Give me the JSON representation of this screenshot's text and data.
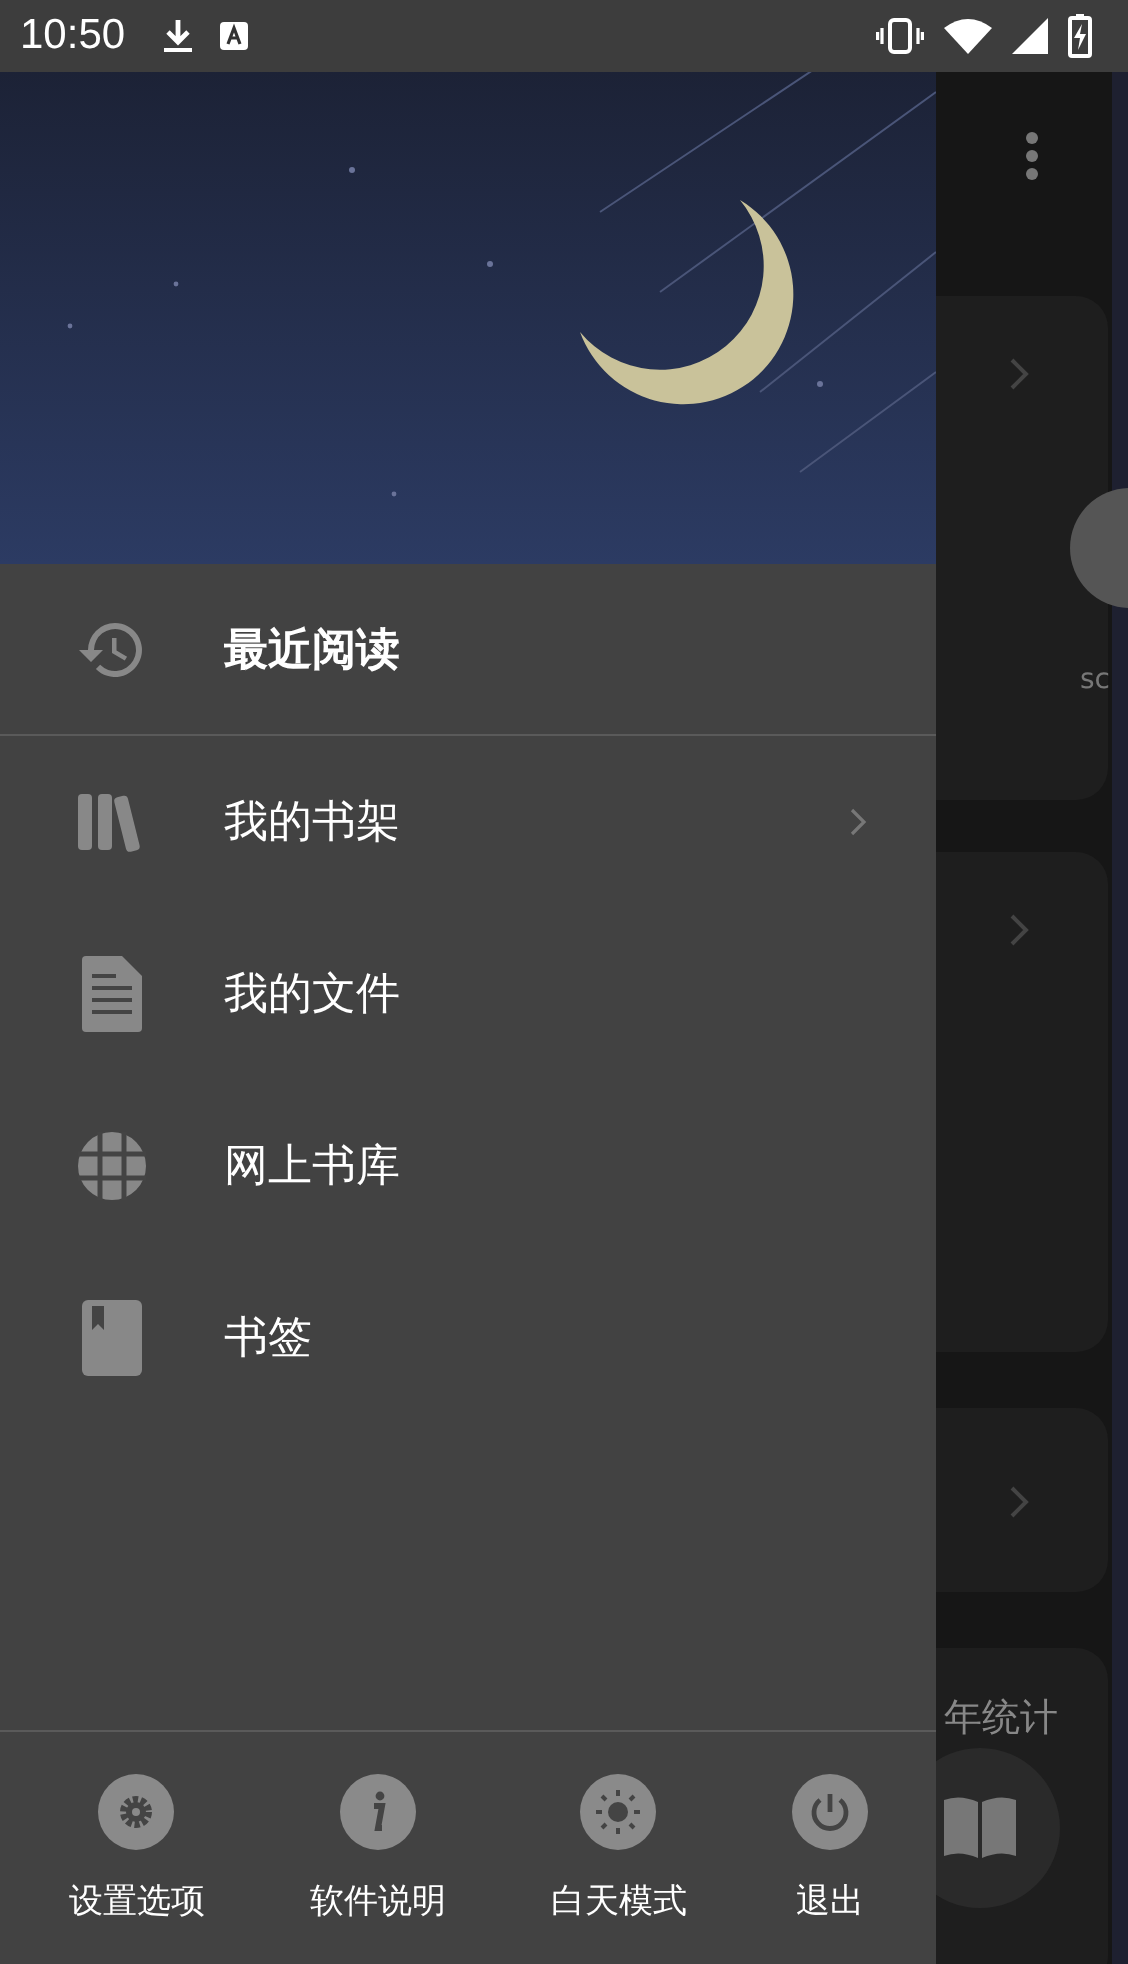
{
  "status_bar": {
    "time": "10:50"
  },
  "drawer": {
    "items": [
      {
        "label": "最近阅读",
        "kind": "history",
        "selected": true,
        "submenu": false
      },
      {
        "label": "我的书架",
        "kind": "shelf",
        "selected": false,
        "submenu": true
      },
      {
        "label": "我的文件",
        "kind": "file",
        "selected": false,
        "submenu": false
      },
      {
        "label": "网上书库",
        "kind": "globe",
        "selected": false,
        "submenu": false
      },
      {
        "label": "书签",
        "kind": "bookmark",
        "selected": false,
        "submenu": false
      }
    ],
    "bottom_actions": [
      {
        "label": "设置选项",
        "kind": "settings"
      },
      {
        "label": "软件说明",
        "kind": "info"
      },
      {
        "label": "白天模式",
        "kind": "sun"
      },
      {
        "label": "退出",
        "kind": "power"
      }
    ]
  },
  "background": {
    "avatar_caption": "sc",
    "stats_title": "年统计"
  }
}
